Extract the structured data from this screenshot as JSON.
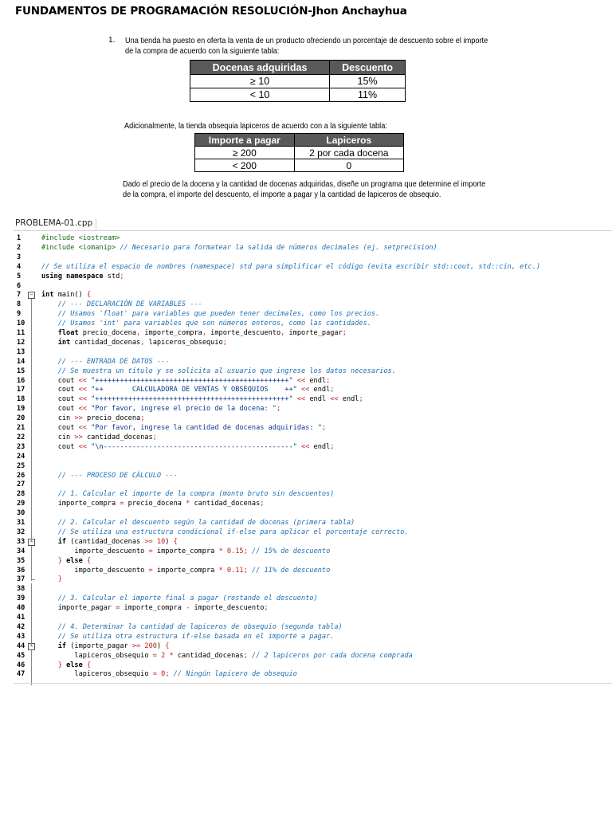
{
  "document": {
    "title": "FUNDAMENTOS DE PROGRAMACIÓN RESOLUCIÓN-Jhon Anchayhua"
  },
  "problem": {
    "number": "1.",
    "intro_lines": [
      "Una tienda ha puesto en oferta la venta de un producto ofreciendo un porcentaje de descuento sobre el importe",
      "de la compra de acuerdo con la siguiente tabla:"
    ],
    "table1": {
      "headers": [
        "Docenas adquiridas",
        "Descuento"
      ],
      "rows": [
        [
          "≥ 10",
          "15%"
        ],
        [
          "< 10",
          "11%"
        ]
      ]
    },
    "additional_text": "Adicionalmente, la tienda obsequia lapiceros de acuerdo con a la siguiente tabla:",
    "table2": {
      "headers": [
        "Importe a pagar",
        "Lapiceros"
      ],
      "rows": [
        [
          "≥ 200",
          "2 por cada docena"
        ],
        [
          "< 200",
          "0"
        ]
      ]
    },
    "task_lines": [
      "Dado el precio de la docena y la cantidad de docenas adquiridas, diseñe un programa que determine el importe",
      "de la compra, el importe del descuento, el importe a pagar y la cantidad de lapiceros de obsequio."
    ]
  },
  "editor": {
    "tab_label": "PROBLEMA-01.cpp",
    "lines": [
      {
        "n": "1",
        "tokens": [
          [
            "pp",
            "#include <iostream>"
          ]
        ]
      },
      {
        "n": "2",
        "tokens": [
          [
            "pp",
            "#include <iomanip>"
          ],
          [
            "tx",
            " "
          ],
          [
            "cm",
            "// Necesario para formatear la salida de números decimales (ej. setprecision)"
          ]
        ]
      },
      {
        "n": "3",
        "tokens": []
      },
      {
        "n": "4",
        "tokens": [
          [
            "cm",
            "// Se utiliza el espacio de nombres (namespace) std para simplificar el código (evita escribir std::cout, std::cin, etc.)"
          ]
        ]
      },
      {
        "n": "5",
        "tokens": [
          [
            "kw",
            "using namespace"
          ],
          [
            "tx",
            " std"
          ],
          [
            "op",
            ";"
          ]
        ]
      },
      {
        "n": "6",
        "tokens": []
      },
      {
        "n": "7",
        "tokens": [
          [
            "kw",
            "int"
          ],
          [
            "tx",
            " main() "
          ],
          [
            "op",
            "{"
          ]
        ]
      },
      {
        "n": "8",
        "tokens": [
          [
            "tx",
            "    "
          ],
          [
            "cm",
            "// --- DECLARACIÓN DE VARIABLES ---"
          ]
        ]
      },
      {
        "n": "9",
        "tokens": [
          [
            "tx",
            "    "
          ],
          [
            "cm",
            "// Usamos 'float' para variables que pueden tener decimales, como los precios."
          ]
        ]
      },
      {
        "n": "10",
        "tokens": [
          [
            "tx",
            "    "
          ],
          [
            "cm",
            "// Usamos 'int' para variables que son números enteros, como las cantidades."
          ]
        ]
      },
      {
        "n": "11",
        "tokens": [
          [
            "tx",
            "    "
          ],
          [
            "kw",
            "float"
          ],
          [
            "tx",
            " precio_docena"
          ],
          [
            "op",
            ","
          ],
          [
            "tx",
            " importe_compra"
          ],
          [
            "op",
            ","
          ],
          [
            "tx",
            " importe_descuento"
          ],
          [
            "op",
            ","
          ],
          [
            "tx",
            " importe_pagar"
          ],
          [
            "op",
            ";"
          ]
        ]
      },
      {
        "n": "12",
        "tokens": [
          [
            "tx",
            "    "
          ],
          [
            "kw",
            "int"
          ],
          [
            "tx",
            " cantidad_docenas"
          ],
          [
            "op",
            ","
          ],
          [
            "tx",
            " lapiceros_obsequio"
          ],
          [
            "op",
            ";"
          ]
        ]
      },
      {
        "n": "13",
        "tokens": []
      },
      {
        "n": "14",
        "tokens": [
          [
            "tx",
            "    "
          ],
          [
            "cm",
            "// --- ENTRADA DE DATOS ---"
          ]
        ]
      },
      {
        "n": "15",
        "tokens": [
          [
            "tx",
            "    "
          ],
          [
            "cm",
            "// Se muestra un título y se solicita al usuario que ingrese los datos necesarios."
          ]
        ]
      },
      {
        "n": "16",
        "tokens": [
          [
            "tx",
            "    cout "
          ],
          [
            "op",
            "<<"
          ],
          [
            "tx",
            " "
          ],
          [
            "str",
            "\"+++++++++++++++++++++++++++++++++++++++++++++++\""
          ],
          [
            "tx",
            " "
          ],
          [
            "op",
            "<<"
          ],
          [
            "tx",
            " endl"
          ],
          [
            "op",
            ";"
          ]
        ]
      },
      {
        "n": "17",
        "tokens": [
          [
            "tx",
            "    cout "
          ],
          [
            "op",
            "<<"
          ],
          [
            "tx",
            " "
          ],
          [
            "str",
            "\"++       CALCULADORA DE VENTAS Y OBSEQUIOS    ++\""
          ],
          [
            "tx",
            " "
          ],
          [
            "op",
            "<<"
          ],
          [
            "tx",
            " endl"
          ],
          [
            "op",
            ";"
          ]
        ]
      },
      {
        "n": "18",
        "tokens": [
          [
            "tx",
            "    cout "
          ],
          [
            "op",
            "<<"
          ],
          [
            "tx",
            " "
          ],
          [
            "str",
            "\"+++++++++++++++++++++++++++++++++++++++++++++++\""
          ],
          [
            "tx",
            " "
          ],
          [
            "op",
            "<<"
          ],
          [
            "tx",
            " endl "
          ],
          [
            "op",
            "<<"
          ],
          [
            "tx",
            " endl"
          ],
          [
            "op",
            ";"
          ]
        ]
      },
      {
        "n": "19",
        "tokens": [
          [
            "tx",
            "    cout "
          ],
          [
            "op",
            "<<"
          ],
          [
            "tx",
            " "
          ],
          [
            "str",
            "\"Por favor, ingrese el precio de la docena: \""
          ],
          [
            "op",
            ";"
          ]
        ]
      },
      {
        "n": "20",
        "tokens": [
          [
            "tx",
            "    cin "
          ],
          [
            "op",
            ">>"
          ],
          [
            "tx",
            " precio_docena"
          ],
          [
            "op",
            ";"
          ]
        ]
      },
      {
        "n": "21",
        "tokens": [
          [
            "tx",
            "    cout "
          ],
          [
            "op",
            "<<"
          ],
          [
            "tx",
            " "
          ],
          [
            "str",
            "\"Por favor, ingrese la cantidad de docenas adquiridas: \""
          ],
          [
            "op",
            ";"
          ]
        ]
      },
      {
        "n": "22",
        "tokens": [
          [
            "tx",
            "    cin "
          ],
          [
            "op",
            ">>"
          ],
          [
            "tx",
            " cantidad_docenas"
          ],
          [
            "op",
            ";"
          ]
        ]
      },
      {
        "n": "23",
        "tokens": [
          [
            "tx",
            "    cout "
          ],
          [
            "op",
            "<<"
          ],
          [
            "tx",
            " "
          ],
          [
            "str",
            "\"\\n----------------------------------------------\""
          ],
          [
            "tx",
            " "
          ],
          [
            "op",
            "<<"
          ],
          [
            "tx",
            " endl"
          ],
          [
            "op",
            ";"
          ]
        ]
      },
      {
        "n": "24",
        "tokens": []
      },
      {
        "n": "25",
        "tokens": []
      },
      {
        "n": "26",
        "tokens": [
          [
            "tx",
            "    "
          ],
          [
            "cm",
            "// --- PROCESO DE CÁLCULO ---"
          ]
        ]
      },
      {
        "n": "27",
        "tokens": []
      },
      {
        "n": "28",
        "tokens": [
          [
            "tx",
            "    "
          ],
          [
            "cm",
            "// 1. Calcular el importe de la compra (monto bruto sin descuentos)"
          ]
        ]
      },
      {
        "n": "29",
        "tokens": [
          [
            "tx",
            "    importe_compra "
          ],
          [
            "op",
            "="
          ],
          [
            "tx",
            " precio_docena "
          ],
          [
            "op",
            "*"
          ],
          [
            "tx",
            " cantidad_docenas"
          ],
          [
            "op",
            ";"
          ]
        ]
      },
      {
        "n": "30",
        "tokens": []
      },
      {
        "n": "31",
        "tokens": [
          [
            "tx",
            "    "
          ],
          [
            "cm",
            "// 2. Calcular el descuento según la cantidad de docenas (primera tabla)"
          ]
        ]
      },
      {
        "n": "32",
        "tokens": [
          [
            "tx",
            "    "
          ],
          [
            "cm",
            "// Se utiliza una estructura condicional if-else para aplicar el porcentaje correcto."
          ]
        ]
      },
      {
        "n": "33",
        "tokens": [
          [
            "tx",
            "    "
          ],
          [
            "kw",
            "if"
          ],
          [
            "tx",
            " (cantidad_docenas "
          ],
          [
            "op",
            ">="
          ],
          [
            "tx",
            " "
          ],
          [
            "num",
            "10"
          ],
          [
            "tx",
            ") "
          ],
          [
            "op",
            "{"
          ]
        ]
      },
      {
        "n": "34",
        "tokens": [
          [
            "tx",
            "        importe_descuento "
          ],
          [
            "op",
            "="
          ],
          [
            "tx",
            " importe_compra "
          ],
          [
            "op",
            "*"
          ],
          [
            "tx",
            " "
          ],
          [
            "num",
            "0.15"
          ],
          [
            "op",
            ";"
          ],
          [
            "tx",
            " "
          ],
          [
            "cm",
            "// 15% de descuento"
          ]
        ]
      },
      {
        "n": "35",
        "tokens": [
          [
            "tx",
            "    "
          ],
          [
            "op",
            "}"
          ],
          [
            "tx",
            " "
          ],
          [
            "kw",
            "else"
          ],
          [
            "tx",
            " "
          ],
          [
            "op",
            "{"
          ]
        ]
      },
      {
        "n": "36",
        "tokens": [
          [
            "tx",
            "        importe_descuento "
          ],
          [
            "op",
            "="
          ],
          [
            "tx",
            " importe_compra "
          ],
          [
            "op",
            "*"
          ],
          [
            "tx",
            " "
          ],
          [
            "num",
            "0.11"
          ],
          [
            "op",
            ";"
          ],
          [
            "tx",
            " "
          ],
          [
            "cm",
            "// 11% de descuento"
          ]
        ]
      },
      {
        "n": "37",
        "tokens": [
          [
            "tx",
            "    "
          ],
          [
            "op",
            "}"
          ]
        ]
      },
      {
        "n": "38",
        "tokens": []
      },
      {
        "n": "39",
        "tokens": [
          [
            "tx",
            "    "
          ],
          [
            "cm",
            "// 3. Calcular el importe final a pagar (restando el descuento)"
          ]
        ]
      },
      {
        "n": "40",
        "tokens": [
          [
            "tx",
            "    importe_pagar "
          ],
          [
            "op",
            "="
          ],
          [
            "tx",
            " importe_compra "
          ],
          [
            "op",
            "-"
          ],
          [
            "tx",
            " importe_descuento"
          ],
          [
            "op",
            ";"
          ]
        ]
      },
      {
        "n": "41",
        "tokens": []
      },
      {
        "n": "42",
        "tokens": [
          [
            "tx",
            "    "
          ],
          [
            "cm",
            "// 4. Determinar la cantidad de lapiceros de obsequio (segunda tabla)"
          ]
        ]
      },
      {
        "n": "43",
        "tokens": [
          [
            "tx",
            "    "
          ],
          [
            "cm",
            "// Se utiliza otra estructura if-else basada en el importe a pagar."
          ]
        ]
      },
      {
        "n": "44",
        "tokens": [
          [
            "tx",
            "    "
          ],
          [
            "kw",
            "if"
          ],
          [
            "tx",
            " (importe_pagar "
          ],
          [
            "op",
            ">="
          ],
          [
            "tx",
            " "
          ],
          [
            "num",
            "200"
          ],
          [
            "tx",
            ") "
          ],
          [
            "op",
            "{"
          ]
        ]
      },
      {
        "n": "45",
        "tokens": [
          [
            "tx",
            "        lapiceros_obsequio "
          ],
          [
            "op",
            "="
          ],
          [
            "tx",
            " "
          ],
          [
            "num",
            "2"
          ],
          [
            "tx",
            " "
          ],
          [
            "op",
            "*"
          ],
          [
            "tx",
            " cantidad_docenas"
          ],
          [
            "op",
            ";"
          ],
          [
            "tx",
            " "
          ],
          [
            "cm",
            "// 2 lapiceros por cada docena comprada"
          ]
        ]
      },
      {
        "n": "46",
        "tokens": [
          [
            "tx",
            "    "
          ],
          [
            "op",
            "}"
          ],
          [
            "tx",
            " "
          ],
          [
            "kw",
            "else"
          ],
          [
            "tx",
            " "
          ],
          [
            "op",
            "{"
          ]
        ]
      },
      {
        "n": "47",
        "tokens": [
          [
            "tx",
            "        lapiceros_obsequio "
          ],
          [
            "op",
            "="
          ],
          [
            "tx",
            " "
          ],
          [
            "num",
            "0"
          ],
          [
            "op",
            ";"
          ],
          [
            "tx",
            " "
          ],
          [
            "cm",
            "// Ningún lapicero de obsequio"
          ]
        ]
      }
    ],
    "fold_markers": [
      "7",
      "33",
      "44"
    ]
  }
}
